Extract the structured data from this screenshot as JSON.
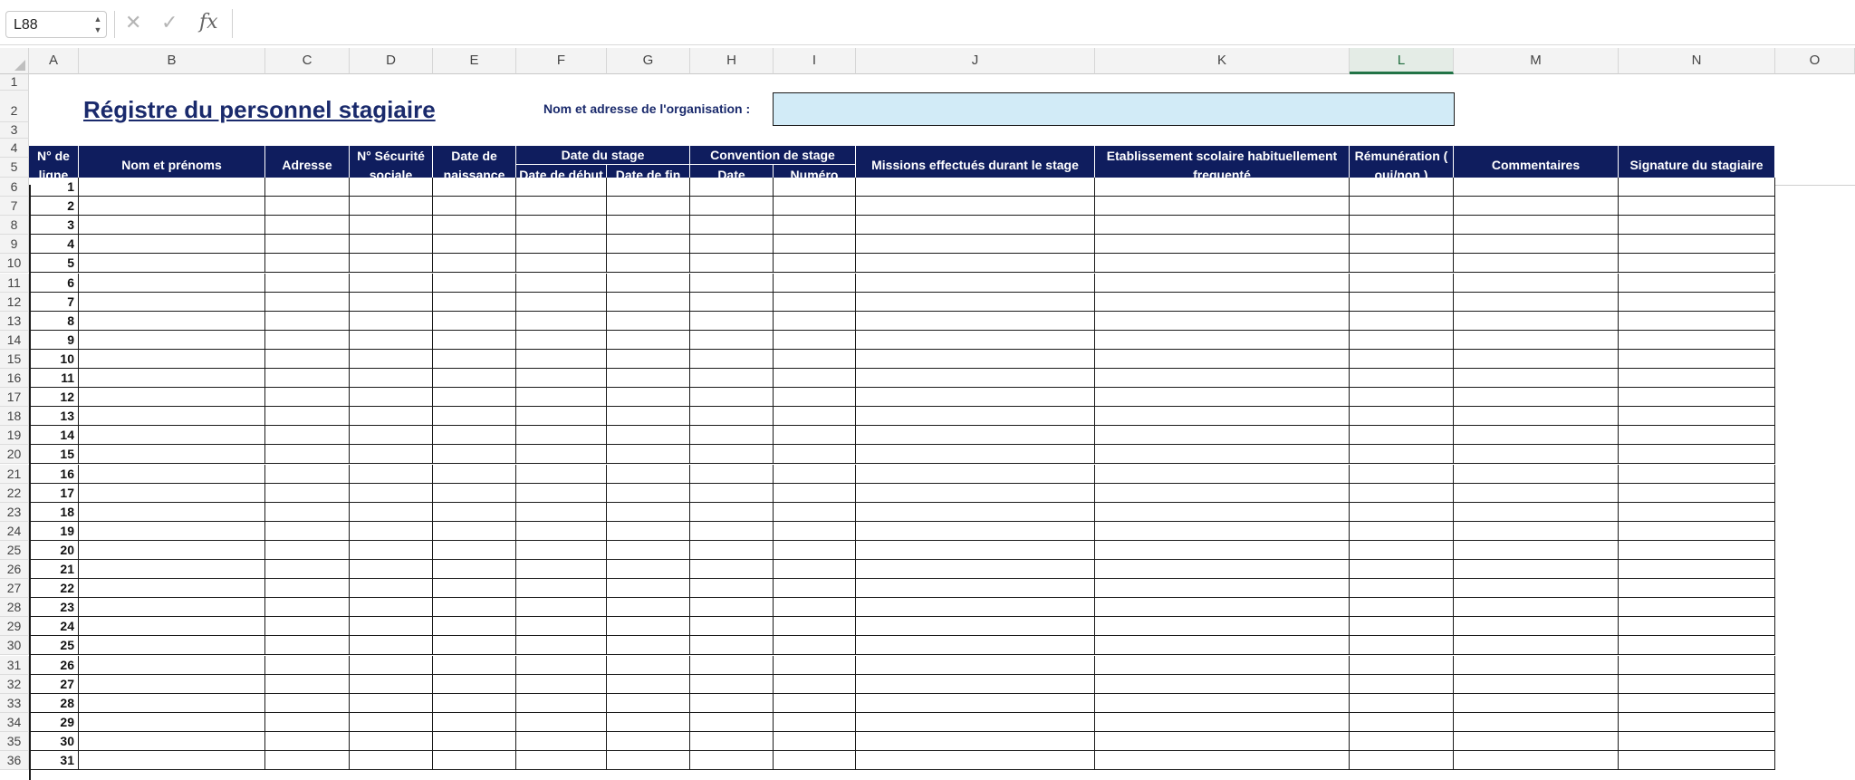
{
  "formula_bar": {
    "name_box": "L88",
    "cancel_icon": "✕",
    "enter_icon": "✓",
    "fx_label": "fx",
    "formula": ""
  },
  "columns": [
    "A",
    "B",
    "C",
    "D",
    "E",
    "F",
    "G",
    "H",
    "I",
    "J",
    "K",
    "L",
    "M",
    "N",
    "O"
  ],
  "selected_column": "L",
  "rows": [
    "1",
    "2",
    "3",
    "4",
    "5",
    "6",
    "7",
    "8",
    "9",
    "10",
    "11",
    "12",
    "13",
    "14",
    "15",
    "16",
    "17",
    "18",
    "19",
    "20",
    "21",
    "22",
    "23",
    "24",
    "25",
    "26",
    "27",
    "28",
    "29",
    "30",
    "31",
    "32",
    "33",
    "34",
    "35",
    "36"
  ],
  "sheet": {
    "title": "Régistre du personnel stagiaire",
    "org_label": "Nom et adresse de l'organisation :",
    "org_value": ""
  },
  "headers": {
    "num_ligne_line1": "N° de",
    "num_ligne_line2": "ligne",
    "nom": "Nom et prénoms",
    "adresse": "Adresse",
    "secu_line1": "N° Sécurité",
    "secu_line2": "sociale",
    "naissance_line1": "Date de",
    "naissance_line2": "naissance",
    "date_stage": "Date du stage",
    "date_debut": "Date de début",
    "date_fin": "Date de fin",
    "convention": "Convention de stage",
    "conv_date": "Date",
    "conv_numero": "Numéro",
    "missions": "Missions effectués durant le stage",
    "etab_line1": "Etablissement scolaire habituellement",
    "etab_line2": "frequenté",
    "remun_line1": "Rémunération (",
    "remun_line2": "oui/non )",
    "commentaires": "Commentaires",
    "signature": "Signature du stagiaire"
  },
  "line_numbers": [
    "1",
    "2",
    "3",
    "4",
    "5",
    "6",
    "7",
    "8",
    "9",
    "10",
    "11",
    "12",
    "13",
    "14",
    "15",
    "16",
    "17",
    "18",
    "19",
    "20",
    "21",
    "22",
    "23",
    "24",
    "25",
    "26",
    "27",
    "28",
    "29",
    "30",
    "31"
  ]
}
